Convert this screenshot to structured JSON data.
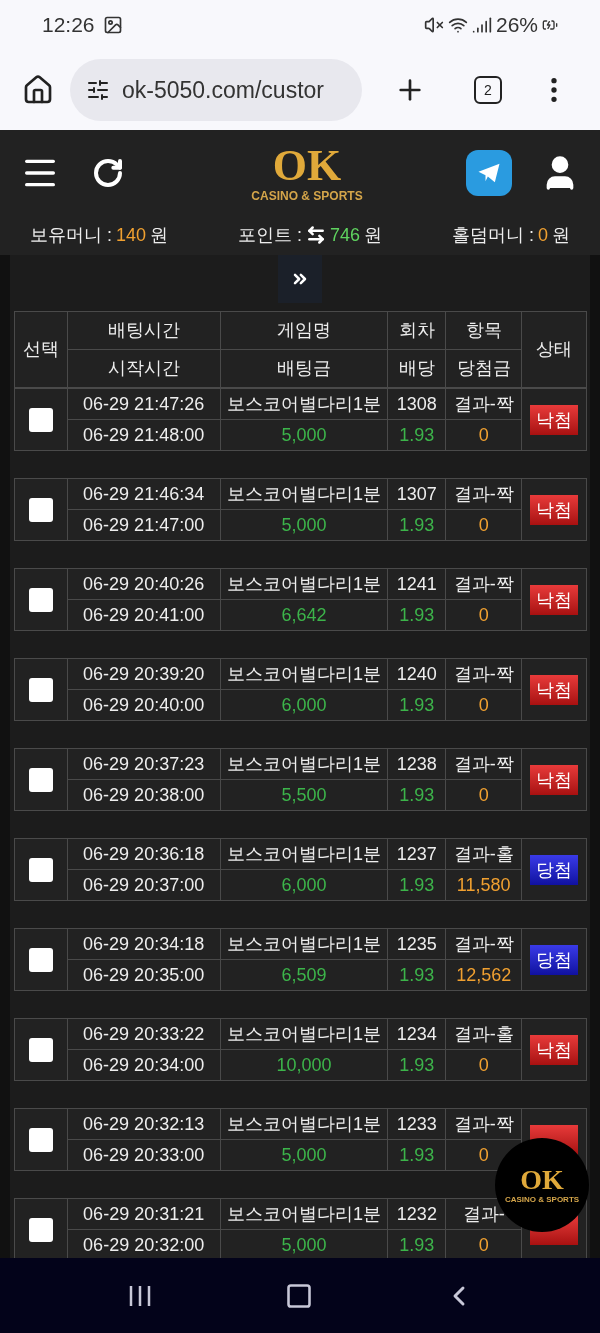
{
  "status_bar": {
    "time": "12:26",
    "battery": "26%"
  },
  "browser": {
    "url": "ok-5050.com/custor",
    "tab_count": "2"
  },
  "header": {
    "logo": "OK",
    "logo_sub": "CASINO & SPORTS"
  },
  "balances": [
    {
      "label": "보유머니 :",
      "value": "140",
      "unit": "원",
      "kind": "plain",
      "color": "#f0a030"
    },
    {
      "label": "포인트 :",
      "value": "746",
      "unit": "원",
      "kind": "exchange",
      "color": "#5fd35f"
    },
    {
      "label": "홀덤머니 :",
      "value": "0",
      "unit": "원",
      "kind": "plain",
      "color": "#f0a030"
    }
  ],
  "table": {
    "columns": {
      "select": "선택",
      "bet_time": "배팅시간",
      "start_time": "시작시간",
      "game": "게임명",
      "amount": "배팅금",
      "round": "회차",
      "odds": "배당",
      "item": "항목",
      "payout": "당첨금",
      "status": "상태"
    },
    "rows": [
      {
        "checked": false,
        "bet_time": "06-29 21:47:26",
        "start_time": "06-29 21:48:00",
        "game": "보스코어별다리1분",
        "amount": "5,000",
        "round": "1308",
        "odds": "1.93",
        "item": "결과-짝",
        "payout": "0",
        "status": "낙첨",
        "kind": "lose"
      },
      {
        "checked": false,
        "bet_time": "06-29 21:46:34",
        "start_time": "06-29 21:47:00",
        "game": "보스코어별다리1분",
        "amount": "5,000",
        "round": "1307",
        "odds": "1.93",
        "item": "결과-짝",
        "payout": "0",
        "status": "낙첨",
        "kind": "lose"
      },
      {
        "checked": false,
        "bet_time": "06-29 20:40:26",
        "start_time": "06-29 20:41:00",
        "game": "보스코어별다리1분",
        "amount": "6,642",
        "round": "1241",
        "odds": "1.93",
        "item": "결과-짝",
        "payout": "0",
        "status": "낙첨",
        "kind": "lose"
      },
      {
        "checked": false,
        "bet_time": "06-29 20:39:20",
        "start_time": "06-29 20:40:00",
        "game": "보스코어별다리1분",
        "amount": "6,000",
        "round": "1240",
        "odds": "1.93",
        "item": "결과-짝",
        "payout": "0",
        "status": "낙첨",
        "kind": "lose"
      },
      {
        "checked": false,
        "bet_time": "06-29 20:37:23",
        "start_time": "06-29 20:38:00",
        "game": "보스코어별다리1분",
        "amount": "5,500",
        "round": "1238",
        "odds": "1.93",
        "item": "결과-짝",
        "payout": "0",
        "status": "낙첨",
        "kind": "lose"
      },
      {
        "checked": false,
        "bet_time": "06-29 20:36:18",
        "start_time": "06-29 20:37:00",
        "game": "보스코어별다리1분",
        "amount": "6,000",
        "round": "1237",
        "odds": "1.93",
        "item": "결과-홀",
        "payout": "11,580",
        "status": "당첨",
        "kind": "win"
      },
      {
        "checked": false,
        "bet_time": "06-29 20:34:18",
        "start_time": "06-29 20:35:00",
        "game": "보스코어별다리1분",
        "amount": "6,509",
        "round": "1235",
        "odds": "1.93",
        "item": "결과-짝",
        "payout": "12,562",
        "status": "당첨",
        "kind": "win"
      },
      {
        "checked": false,
        "bet_time": "06-29 20:33:22",
        "start_time": "06-29 20:34:00",
        "game": "보스코어별다리1분",
        "amount": "10,000",
        "round": "1234",
        "odds": "1.93",
        "item": "결과-홀",
        "payout": "0",
        "status": "낙첨",
        "kind": "lose"
      },
      {
        "checked": false,
        "bet_time": "06-29 20:32:13",
        "start_time": "06-29 20:33:00",
        "game": "보스코어별다리1분",
        "amount": "5,000",
        "round": "1233",
        "odds": "1.93",
        "item": "결과-짝",
        "payout": "0",
        "kind": "lose"
      },
      {
        "checked": false,
        "bet_time": "06-29 20:31:21",
        "start_time": "06-29 20:32:00",
        "game": "보스코어별다리1분",
        "amount": "5,000",
        "round": "1232",
        "odds": "1.93",
        "item": "결과-",
        "payout": "0",
        "kind": "lose"
      }
    ]
  },
  "floating_logo": {
    "logo": "OK",
    "logo_sub": "CASINO & SPORTS"
  }
}
